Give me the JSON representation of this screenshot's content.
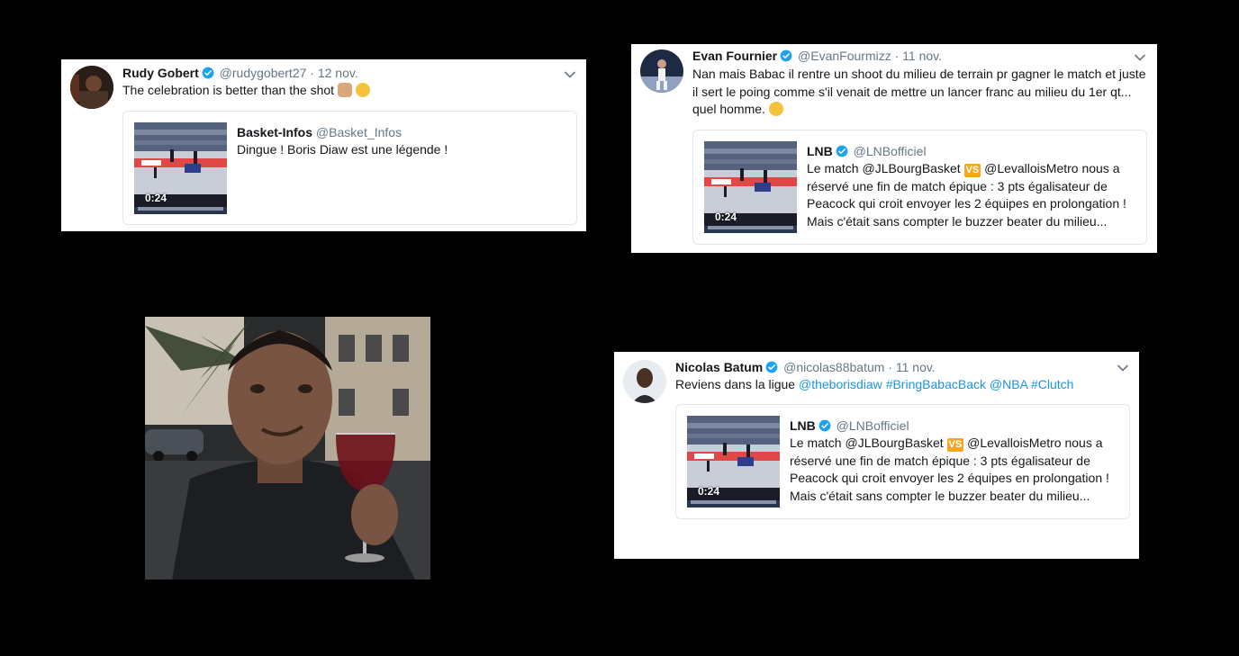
{
  "tweet_rudy": {
    "name": "Rudy Gobert",
    "handle": "@rudygobert27",
    "dot": "·",
    "date": "12 nov.",
    "text": "The celebration is better than the shot",
    "quote": {
      "name": "Basket-Infos",
      "handle": "@Basket_Infos",
      "text": "Dingue ! Boris Diaw est une légende !",
      "duration": "0:24"
    }
  },
  "tweet_evan": {
    "name": "Evan Fournier",
    "handle": "@EvanFourmizz",
    "dot": "·",
    "date": "11 nov.",
    "text_line1": "Nan mais Babac il rentre un shoot du milieu de terrain pr gagner le match et juste",
    "text_line2": "il sert le poing comme s'il venait de mettre un lancer franc au milieu du 1er qt...",
    "text_line3": "quel homme.",
    "quote": {
      "name": "LNB",
      "handle": "@LNBofficiel",
      "line1_a": "Le match @JLBourgBasket",
      "vs": "VS",
      "line1_b": "@LevalloisMetro nous a",
      "line2": "réservé une fin de match épique : 3 pts égalisateur de",
      "line3": "Peacock qui croit envoyer les 2 équipes en prolongation !",
      "line4": "Mais c'était sans compter le buzzer beater du milieu...",
      "duration": "0:24"
    }
  },
  "tweet_nicolas": {
    "name": "Nicolas Batum",
    "handle": "@nicolas88batum",
    "dot": "·",
    "date": "11 nov.",
    "text": "Reviens dans la ligue",
    "links": [
      "@theborisdiaw",
      "#BringBabacBack",
      "@NBA",
      "#Clutch"
    ],
    "quote": {
      "name": "LNB",
      "handle": "@LNBofficiel",
      "line1_a": "Le match @JLBourgBasket",
      "vs": "VS",
      "line1_b": "@LevalloisMetro nous a",
      "line2": "réservé une fin de match épique : 3 pts égalisateur de",
      "line3": "Peacock qui croit envoyer les 2 équipes en prolongation !",
      "line4": "Mais c'était sans compter le buzzer beater du milieu...",
      "duration": "0:24"
    }
  },
  "colors": {
    "link": "#1b95e0",
    "verified": "#1da1f2",
    "muted": "#657786",
    "vs": "#f6a623"
  }
}
